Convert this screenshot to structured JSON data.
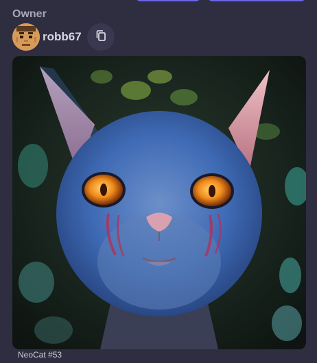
{
  "owner": {
    "label": "Owner",
    "username": "robb67"
  },
  "nft": {
    "name": "NeoCat #53"
  },
  "icons": {
    "avatar": "avatar-face",
    "copy": "copy-icon"
  },
  "colors": {
    "page_bg": "#2f2d40",
    "accent": "#4b46c8",
    "label_muted": "#a9a6b6",
    "text_light": "#d8d6e2"
  }
}
